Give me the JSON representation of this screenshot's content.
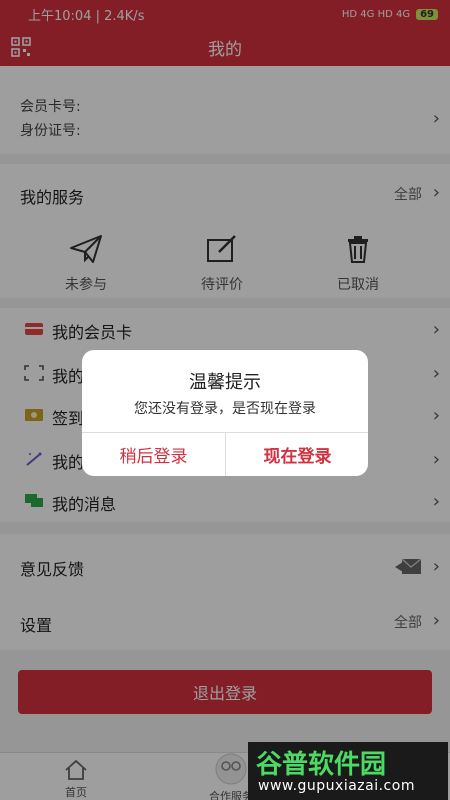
{
  "status_bar": {
    "time": "上午10:04 | 2.4K/s",
    "indicators": "HD 4G HD 4G",
    "battery": "69"
  },
  "header": {
    "title": "我的",
    "left_icon": "qr-scan-icon"
  },
  "account": {
    "card_label": "会员卡号:",
    "id_label": "身份证号:"
  },
  "services": {
    "title": "我的服务",
    "all_label": "全部",
    "items": [
      {
        "label": "未参与",
        "icon": "paper-plane-icon"
      },
      {
        "label": "待评价",
        "icon": "edit-icon"
      },
      {
        "label": "已取消",
        "icon": "trash-icon"
      }
    ]
  },
  "menu": {
    "items": [
      {
        "label": "我的会员卡",
        "icon": "card-icon",
        "color": "#e64646"
      },
      {
        "label": "我的",
        "icon": "scan-frame-icon",
        "color": "#555555"
      },
      {
        "label": "签到",
        "icon": "checkin-icon",
        "color": "#c9a227"
      },
      {
        "label": "我的",
        "icon": "magic-wand-icon",
        "color": "#6a5acd"
      },
      {
        "label": "我的消息",
        "icon": "chat-icon",
        "color": "#2eaa4a"
      }
    ]
  },
  "feedback": {
    "label": "意见反馈",
    "icon": "reply-mail-icon"
  },
  "settings": {
    "label": "设置",
    "all_label": "全部"
  },
  "logout": {
    "label": "退出登录"
  },
  "tabbar": {
    "tabs": [
      {
        "label": "首页",
        "icon": "home-icon"
      },
      {
        "label": "合作服务",
        "icon": "partner-icon"
      }
    ]
  },
  "dialog": {
    "title": "温馨提示",
    "message": "您还没有登录，是否现在登录",
    "later": "稍后登录",
    "now": "现在登录"
  },
  "watermark": {
    "brand": "谷普软件园",
    "url": "www.gupuxiazai.com"
  },
  "colors": {
    "accent": "#d3313f"
  }
}
